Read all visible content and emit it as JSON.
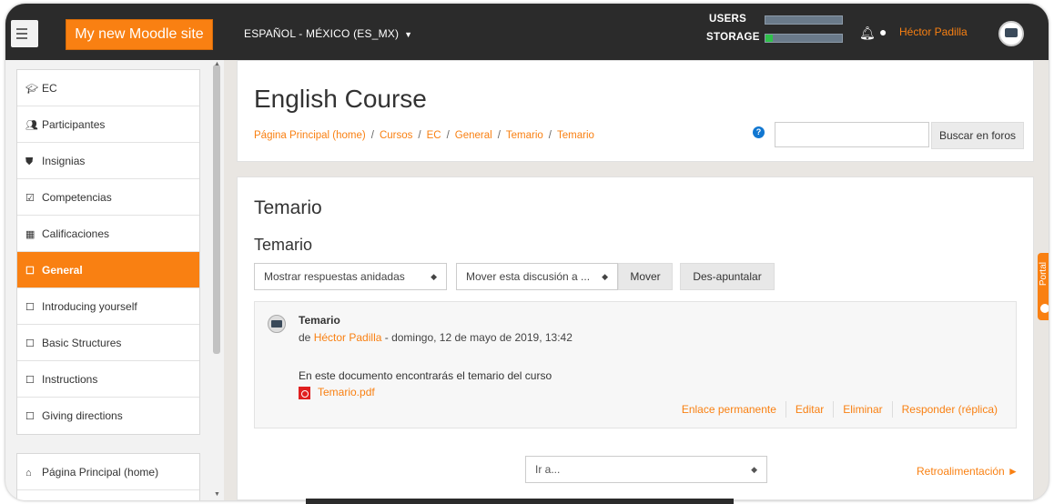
{
  "navbar": {
    "brand": "My new Moodle site",
    "language": "ESPAÑOL - MÉXICO (ES_MX)",
    "usage": {
      "users_label": "USERS",
      "users_fill": 0.0,
      "storage_label": "STORAGE",
      "storage_fill": 0.1
    },
    "user_name": "Héctor Padilla"
  },
  "sidebar": {
    "course_items": [
      {
        "label": "EC",
        "icon": "graduation-cap-icon",
        "active": false
      },
      {
        "label": "Participantes",
        "icon": "users-icon",
        "active": false
      },
      {
        "label": "Insignias",
        "icon": "shield-icon",
        "active": false
      },
      {
        "label": "Competencias",
        "icon": "check-square-icon",
        "active": false
      },
      {
        "label": "Calificaciones",
        "icon": "table-icon",
        "active": false
      },
      {
        "label": "General",
        "icon": "folder-icon",
        "active": true
      },
      {
        "label": "Introducing yourself",
        "icon": "folder-icon",
        "active": false
      },
      {
        "label": "Basic Structures",
        "icon": "folder-icon",
        "active": false
      },
      {
        "label": "Instructions",
        "icon": "folder-icon",
        "active": false
      },
      {
        "label": "Giving directions",
        "icon": "folder-icon",
        "active": false
      }
    ],
    "site_items": [
      {
        "label": "Página Principal (home)",
        "icon": "home-icon"
      }
    ]
  },
  "header": {
    "course_title": "English Course",
    "breadcrumb": [
      "Página Principal (home)",
      "Cursos",
      "EC",
      "General",
      "Temario",
      "Temario"
    ],
    "search_button": "Buscar en foros",
    "search_value": ""
  },
  "forum": {
    "title": "Temario",
    "discussion_title": "Temario",
    "display_mode": "Mostrar respuestas anidadas",
    "move_select": "Mover esta discusión a ...",
    "move_button": "Mover",
    "unpin_button": "Des-apuntalar",
    "post": {
      "subject": "Temario",
      "by_prefix": "de",
      "author": "Héctor Padilla",
      "date": "- domingo, 12 de mayo de 2019, 13:42",
      "message": "En este documento encontrarás el temario del curso",
      "attachment": "Temario.pdf",
      "commands": [
        "Enlace permanente",
        "Editar",
        "Eliminar",
        "Responder (réplica)"
      ]
    },
    "jump_select": "Ir a...",
    "next_link": "Retroalimentación ►"
  },
  "portal_tab": "Portal",
  "colors": {
    "accent": "#f98012",
    "navbar": "#2b2b2b",
    "usage_fill": "#2fc04a"
  }
}
